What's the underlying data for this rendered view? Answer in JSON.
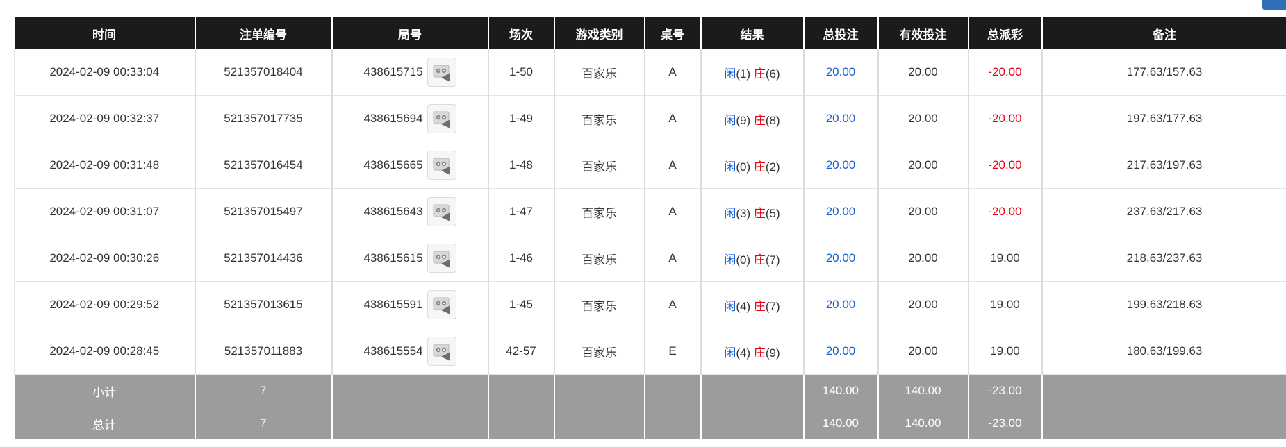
{
  "columns": [
    "时间",
    "注单编号",
    "局号",
    "场次",
    "游戏类别",
    "桌号",
    "结果",
    "总投注",
    "有效投注",
    "总派彩",
    "备注"
  ],
  "result_labels": {
    "player": "闲",
    "banker": "庄"
  },
  "colors": {
    "header_bg": "#1b1b1b",
    "summary_bg": "#9c9c9c",
    "blue": "#1a5fd6",
    "red": "#e60012"
  },
  "icons": {
    "replay": "video-replay-icon"
  },
  "rows": [
    {
      "time": "2024-02-09 00:33:04",
      "bet_id": "521357018404",
      "round_id": "438615715",
      "session": "1-50",
      "game": "百家乐",
      "table": "A",
      "player_score": "(1)",
      "banker_score": "(6)",
      "total_bet": "20.00",
      "valid_bet": "20.00",
      "payout": "-20.00",
      "payout_negative": true,
      "note": "177.63/157.63"
    },
    {
      "time": "2024-02-09 00:32:37",
      "bet_id": "521357017735",
      "round_id": "438615694",
      "session": "1-49",
      "game": "百家乐",
      "table": "A",
      "player_score": "(9)",
      "banker_score": "(8)",
      "total_bet": "20.00",
      "valid_bet": "20.00",
      "payout": "-20.00",
      "payout_negative": true,
      "note": "197.63/177.63"
    },
    {
      "time": "2024-02-09 00:31:48",
      "bet_id": "521357016454",
      "round_id": "438615665",
      "session": "1-48",
      "game": "百家乐",
      "table": "A",
      "player_score": "(0)",
      "banker_score": "(2)",
      "total_bet": "20.00",
      "valid_bet": "20.00",
      "payout": "-20.00",
      "payout_negative": true,
      "note": "217.63/197.63"
    },
    {
      "time": "2024-02-09 00:31:07",
      "bet_id": "521357015497",
      "round_id": "438615643",
      "session": "1-47",
      "game": "百家乐",
      "table": "A",
      "player_score": "(3)",
      "banker_score": "(5)",
      "total_bet": "20.00",
      "valid_bet": "20.00",
      "payout": "-20.00",
      "payout_negative": true,
      "note": "237.63/217.63"
    },
    {
      "time": "2024-02-09 00:30:26",
      "bet_id": "521357014436",
      "round_id": "438615615",
      "session": "1-46",
      "game": "百家乐",
      "table": "A",
      "player_score": "(0)",
      "banker_score": "(7)",
      "total_bet": "20.00",
      "valid_bet": "20.00",
      "payout": "19.00",
      "payout_negative": false,
      "note": "218.63/237.63"
    },
    {
      "time": "2024-02-09 00:29:52",
      "bet_id": "521357013615",
      "round_id": "438615591",
      "session": "1-45",
      "game": "百家乐",
      "table": "A",
      "player_score": "(4)",
      "banker_score": "(7)",
      "total_bet": "20.00",
      "valid_bet": "20.00",
      "payout": "19.00",
      "payout_negative": false,
      "note": "199.63/218.63"
    },
    {
      "time": "2024-02-09 00:28:45",
      "bet_id": "521357011883",
      "round_id": "438615554",
      "session": "42-57",
      "game": "百家乐",
      "table": "E",
      "player_score": "(4)",
      "banker_score": "(9)",
      "total_bet": "20.00",
      "valid_bet": "20.00",
      "payout": "19.00",
      "payout_negative": false,
      "note": "180.63/199.63"
    }
  ],
  "subtotal": {
    "label": "小计",
    "count": "7",
    "total_bet": "140.00",
    "valid_bet": "140.00",
    "payout": "-23.00"
  },
  "total": {
    "label": "总计",
    "count": "7",
    "total_bet": "140.00",
    "valid_bet": "140.00",
    "payout": "-23.00"
  }
}
